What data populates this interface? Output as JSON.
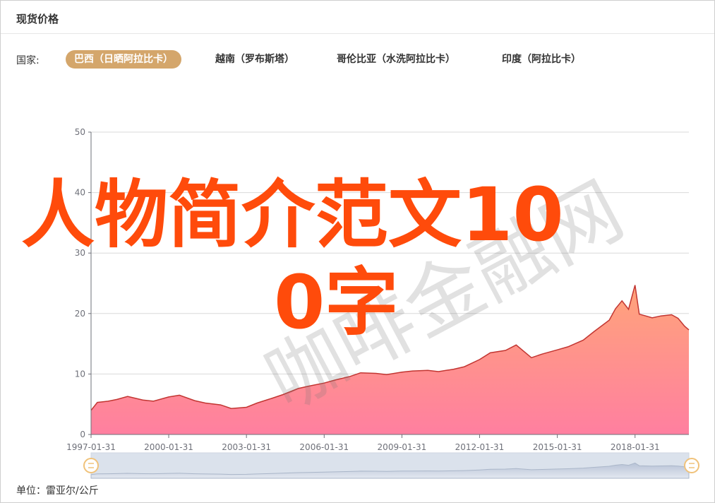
{
  "panel": {
    "title": "现货价格",
    "country_label": "国家:",
    "tabs": [
      {
        "label": "巴西（日晒阿拉比卡）",
        "active": true
      },
      {
        "label": "越南（罗布斯塔）",
        "active": false
      },
      {
        "label": "哥伦比亚（水洗阿拉比卡）",
        "active": false
      },
      {
        "label": "印度（阿拉比卡）",
        "active": false
      }
    ],
    "unit": "单位：雷亚尔/公斤"
  },
  "overlay": {
    "headline_line1": "人物简介范文10",
    "headline_line2": "0字",
    "faint_watermark": "咖啡金融网",
    "headline_color": "#ff4b0b"
  },
  "chart_data": {
    "type": "area",
    "ylim": [
      0,
      50
    ],
    "yticks": [
      "0",
      "10",
      "20",
      "30",
      "40",
      "50"
    ],
    "xticks": [
      "1997-01-31",
      "2000-01-31",
      "2003-01-31",
      "2006-01-31",
      "2009-01-31",
      "2012-01-31",
      "2015-01-31",
      "2018-01-31"
    ],
    "xrange": [
      "1997-01-31",
      "2020-02-29"
    ],
    "series": [
      {
        "points": [
          [
            "1997-01-31",
            4.0
          ],
          [
            "1997-04-30",
            5.3
          ],
          [
            "1997-09-30",
            5.5
          ],
          [
            "1998-01-31",
            5.8
          ],
          [
            "1998-06-30",
            6.3
          ],
          [
            "1999-01-31",
            5.7
          ],
          [
            "1999-06-30",
            5.5
          ],
          [
            "2000-01-31",
            6.2
          ],
          [
            "2000-06-30",
            6.5
          ],
          [
            "2001-01-31",
            5.6
          ],
          [
            "2001-06-30",
            5.2
          ],
          [
            "2002-01-31",
            4.9
          ],
          [
            "2002-06-30",
            4.3
          ],
          [
            "2003-01-31",
            4.5
          ],
          [
            "2003-06-30",
            5.2
          ],
          [
            "2004-01-31",
            6.0
          ],
          [
            "2004-06-30",
            6.6
          ],
          [
            "2005-01-31",
            7.6
          ],
          [
            "2005-06-30",
            8.0
          ],
          [
            "2006-01-31",
            8.5
          ],
          [
            "2006-06-30",
            9.0
          ],
          [
            "2007-01-31",
            9.6
          ],
          [
            "2007-06-30",
            10.2
          ],
          [
            "2008-01-31",
            10.1
          ],
          [
            "2008-06-30",
            9.9
          ],
          [
            "2009-01-31",
            10.3
          ],
          [
            "2009-06-30",
            10.5
          ],
          [
            "2010-01-31",
            10.6
          ],
          [
            "2010-06-30",
            10.4
          ],
          [
            "2011-01-31",
            10.8
          ],
          [
            "2011-06-30",
            11.2
          ],
          [
            "2012-01-31",
            12.4
          ],
          [
            "2012-06-30",
            13.5
          ],
          [
            "2013-01-31",
            13.9
          ],
          [
            "2013-06-30",
            14.8
          ],
          [
            "2014-01-31",
            12.7
          ],
          [
            "2014-06-30",
            13.3
          ],
          [
            "2015-01-31",
            14.0
          ],
          [
            "2015-06-30",
            14.5
          ],
          [
            "2016-01-31",
            15.6
          ],
          [
            "2016-06-30",
            17.0
          ],
          [
            "2017-01-31",
            18.9
          ],
          [
            "2017-04-30",
            20.8
          ],
          [
            "2017-07-31",
            22.1
          ],
          [
            "2017-10-31",
            20.7
          ],
          [
            "2018-01-31",
            24.7
          ],
          [
            "2018-03-31",
            19.9
          ],
          [
            "2018-06-30",
            19.6
          ],
          [
            "2018-09-30",
            19.3
          ],
          [
            "2019-01-31",
            19.6
          ],
          [
            "2019-06-30",
            19.8
          ],
          [
            "2019-09-30",
            19.2
          ],
          [
            "2019-12-31",
            17.9
          ],
          [
            "2020-02-29",
            17.3
          ]
        ]
      }
    ],
    "colors": {
      "line": "#c23531",
      "fill_top": "#ffa47a",
      "fill_bottom": "#ff7fa0",
      "grid": "#d9d9d9",
      "axis": "#6e7079"
    },
    "slider": true
  }
}
